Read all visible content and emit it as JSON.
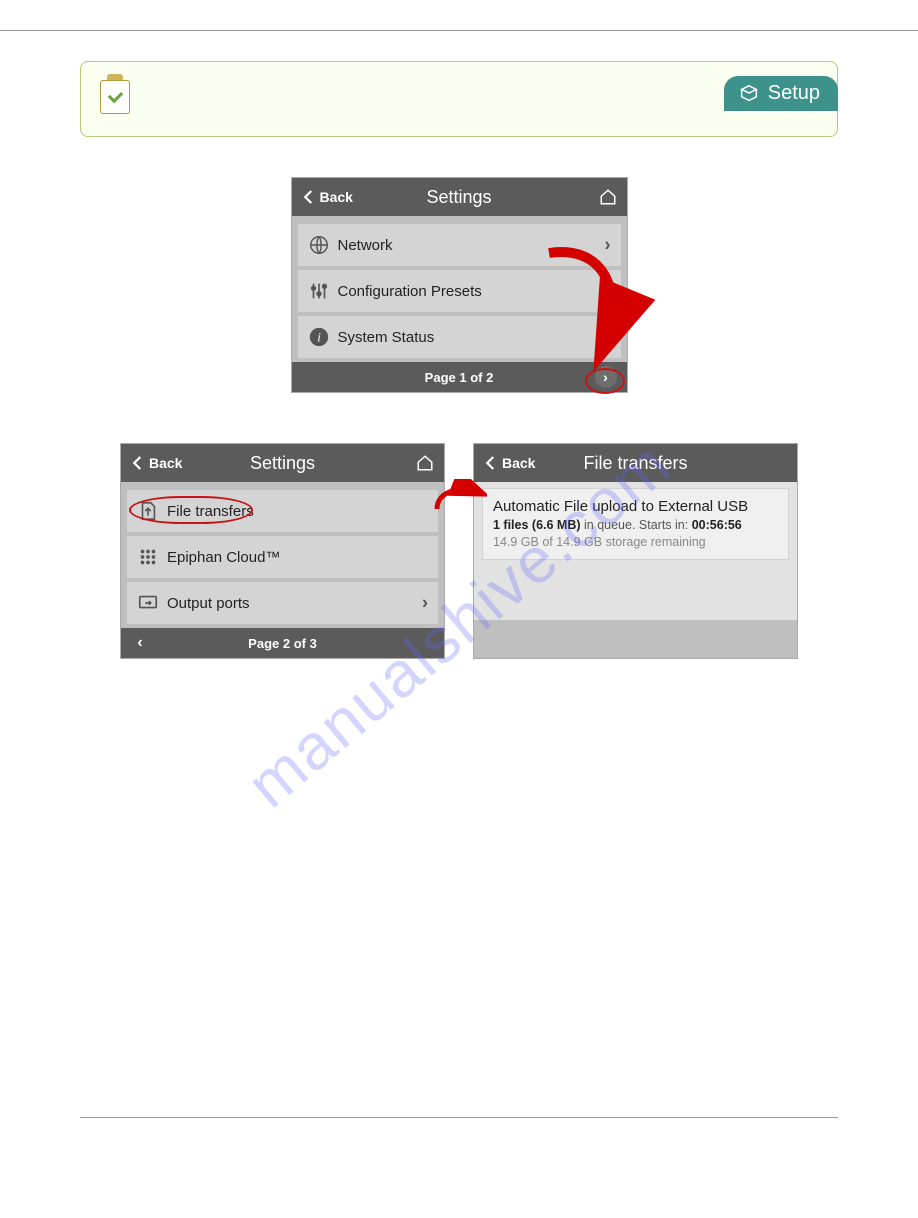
{
  "header": {
    "tab_label": "Setup"
  },
  "watermark": "manualshive.com",
  "screen1": {
    "title": "Settings",
    "back": "Back",
    "rows": [
      {
        "label": "Network"
      },
      {
        "label": "Configuration Presets"
      },
      {
        "label": "System Status"
      }
    ],
    "footer": "Page 1 of 2"
  },
  "screen2": {
    "title": "Settings",
    "back": "Back",
    "rows": [
      {
        "label": "File transfers"
      },
      {
        "label": "Epiphan Cloud™"
      },
      {
        "label": "Output ports"
      }
    ],
    "footer": "Page 2 of 3"
  },
  "screen3": {
    "title": "File transfers",
    "back": "Back",
    "card": {
      "line1": "Automatic File upload to External USB",
      "line2_bold1": "1 files (6.6 MB)",
      "line2_mid": " in queue. Starts in: ",
      "line2_bold2": "00:56:56",
      "line3": "14.9 GB of 14.9 GB storage remaining"
    }
  }
}
